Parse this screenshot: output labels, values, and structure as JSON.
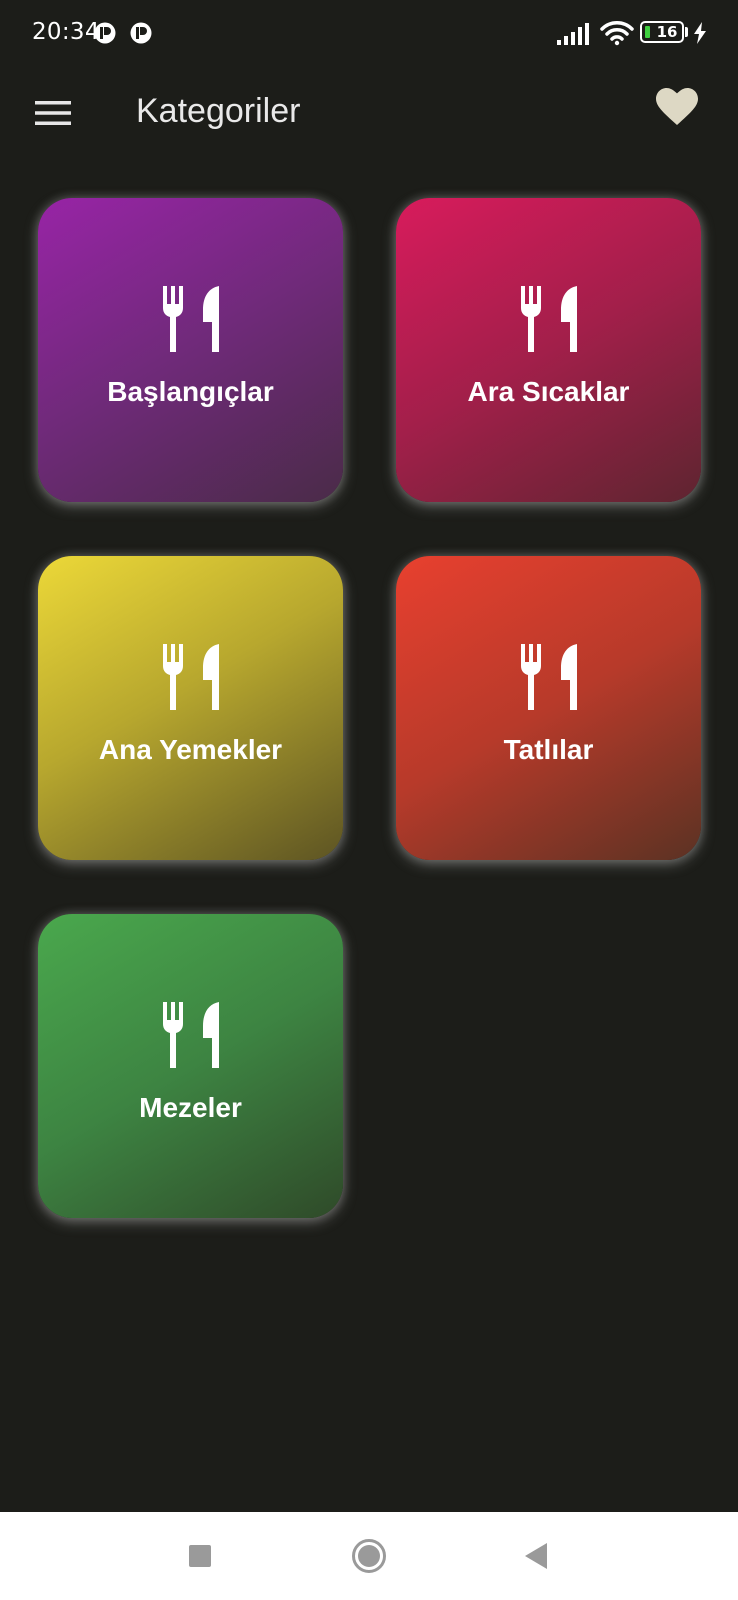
{
  "status_bar": {
    "time": "20:34",
    "battery_level": "16",
    "icons": [
      "notification-icon",
      "notification-icon",
      "signal-icon",
      "wifi-icon",
      "battery-icon",
      "charging-icon"
    ]
  },
  "app_bar": {
    "title": "Kategoriler",
    "menu_icon": "menu-icon",
    "favorite_icon": "heart-icon"
  },
  "categories": [
    {
      "label": "Başlangıçlar",
      "icon": "restaurant-icon",
      "color": "#9c27b0"
    },
    {
      "label": "Ara Sıcaklar",
      "icon": "restaurant-icon",
      "color": "#e91e63"
    },
    {
      "label": "Ana Yemekler",
      "icon": "restaurant-icon",
      "color": "#ffeb3b"
    },
    {
      "label": "Tatlılar",
      "icon": "restaurant-icon",
      "color": "#f44336"
    },
    {
      "label": "Mezeler",
      "icon": "restaurant-icon",
      "color": "#4caf50"
    }
  ],
  "nav_bar": {
    "buttons": [
      "recents-square-icon",
      "home-circle-icon",
      "back-triangle-icon"
    ]
  },
  "colors": {
    "background": "#1c1d19",
    "heart": "#ddd8c4"
  }
}
